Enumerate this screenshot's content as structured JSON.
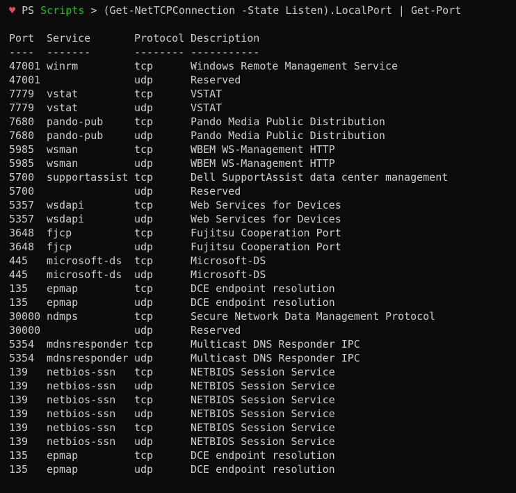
{
  "prompt": {
    "heart_glyph": "♥",
    "ps_label": "PS",
    "directory": "Scripts",
    "gt": ">",
    "command": "(Get-NetTCPConnection -State Listen).LocalPort | Get-Port",
    "colors": {
      "heart": "#e74856",
      "directory": "#16c60c",
      "text": "#cccccc",
      "background": "#0c0c0c"
    }
  },
  "table": {
    "headers": {
      "port": "Port",
      "service": "Service",
      "protocol": "Protocol",
      "description": "Description"
    },
    "separators": {
      "port": "----",
      "service": "-------",
      "protocol": "--------",
      "description": "-----------"
    },
    "rows": [
      {
        "port": "47001",
        "service": "winrm",
        "protocol": "tcp",
        "description": "Windows Remote Management Service"
      },
      {
        "port": "47001",
        "service": "",
        "protocol": "udp",
        "description": "Reserved"
      },
      {
        "port": "7779",
        "service": "vstat",
        "protocol": "tcp",
        "description": "VSTAT"
      },
      {
        "port": "7779",
        "service": "vstat",
        "protocol": "udp",
        "description": "VSTAT"
      },
      {
        "port": "7680",
        "service": "pando-pub",
        "protocol": "tcp",
        "description": "Pando Media Public Distribution"
      },
      {
        "port": "7680",
        "service": "pando-pub",
        "protocol": "udp",
        "description": "Pando Media Public Distribution"
      },
      {
        "port": "5985",
        "service": "wsman",
        "protocol": "tcp",
        "description": "WBEM WS-Management HTTP"
      },
      {
        "port": "5985",
        "service": "wsman",
        "protocol": "udp",
        "description": "WBEM WS-Management HTTP"
      },
      {
        "port": "5700",
        "service": "supportassist",
        "protocol": "tcp",
        "description": "Dell SupportAssist data center management"
      },
      {
        "port": "5700",
        "service": "",
        "protocol": "udp",
        "description": "Reserved"
      },
      {
        "port": "5357",
        "service": "wsdapi",
        "protocol": "tcp",
        "description": "Web Services for Devices"
      },
      {
        "port": "5357",
        "service": "wsdapi",
        "protocol": "udp",
        "description": "Web Services for Devices"
      },
      {
        "port": "3648",
        "service": "fjcp",
        "protocol": "tcp",
        "description": "Fujitsu Cooperation Port"
      },
      {
        "port": "3648",
        "service": "fjcp",
        "protocol": "udp",
        "description": "Fujitsu Cooperation Port"
      },
      {
        "port": "445",
        "service": "microsoft-ds",
        "protocol": "tcp",
        "description": "Microsoft-DS"
      },
      {
        "port": "445",
        "service": "microsoft-ds",
        "protocol": "udp",
        "description": "Microsoft-DS"
      },
      {
        "port": "135",
        "service": "epmap",
        "protocol": "tcp",
        "description": "DCE endpoint resolution"
      },
      {
        "port": "135",
        "service": "epmap",
        "protocol": "udp",
        "description": "DCE endpoint resolution"
      },
      {
        "port": "30000",
        "service": "ndmps",
        "protocol": "tcp",
        "description": "Secure Network Data Management Protocol"
      },
      {
        "port": "30000",
        "service": "",
        "protocol": "udp",
        "description": "Reserved"
      },
      {
        "port": "5354",
        "service": "mdnsresponder",
        "protocol": "tcp",
        "description": "Multicast DNS Responder IPC"
      },
      {
        "port": "5354",
        "service": "mdnsresponder",
        "protocol": "udp",
        "description": "Multicast DNS Responder IPC"
      },
      {
        "port": "139",
        "service": "netbios-ssn",
        "protocol": "tcp",
        "description": "NETBIOS Session Service"
      },
      {
        "port": "139",
        "service": "netbios-ssn",
        "protocol": "udp",
        "description": "NETBIOS Session Service"
      },
      {
        "port": "139",
        "service": "netbios-ssn",
        "protocol": "tcp",
        "description": "NETBIOS Session Service"
      },
      {
        "port": "139",
        "service": "netbios-ssn",
        "protocol": "udp",
        "description": "NETBIOS Session Service"
      },
      {
        "port": "139",
        "service": "netbios-ssn",
        "protocol": "tcp",
        "description": "NETBIOS Session Service"
      },
      {
        "port": "139",
        "service": "netbios-ssn",
        "protocol": "udp",
        "description": "NETBIOS Session Service"
      },
      {
        "port": "135",
        "service": "epmap",
        "protocol": "tcp",
        "description": "DCE endpoint resolution"
      },
      {
        "port": "135",
        "service": "epmap",
        "protocol": "udp",
        "description": "DCE endpoint resolution"
      }
    ]
  }
}
